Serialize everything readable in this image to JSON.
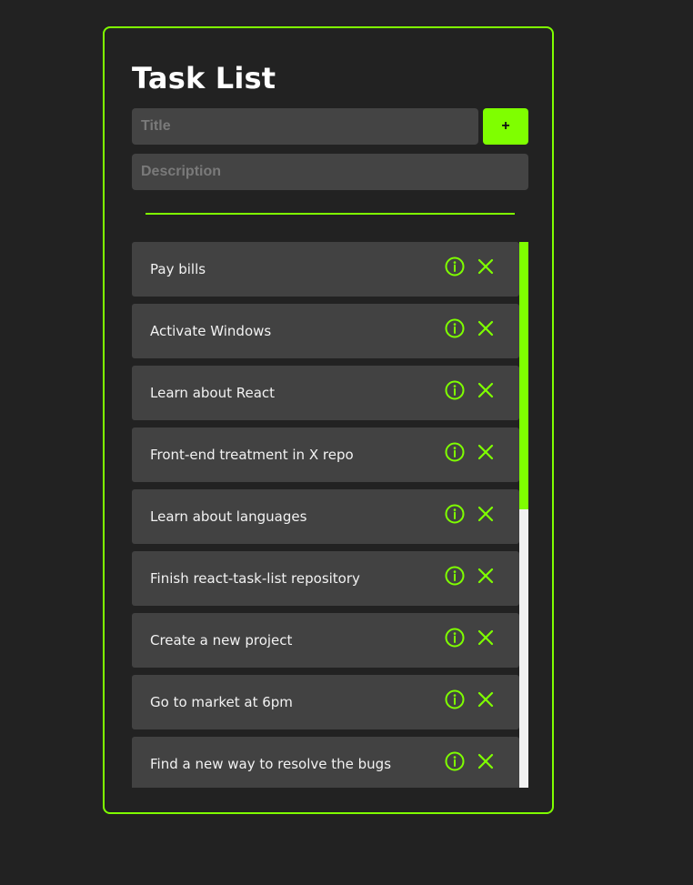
{
  "app": {
    "title": "Task List"
  },
  "form": {
    "title_placeholder": "Title",
    "title_value": "",
    "description_placeholder": "Description",
    "description_value": "",
    "add_label": "+"
  },
  "tasks": [
    {
      "label": "Pay bills"
    },
    {
      "label": "Activate Windows"
    },
    {
      "label": "Learn about React"
    },
    {
      "label": "Front-end treatment in X repo"
    },
    {
      "label": "Learn about languages"
    },
    {
      "label": "Finish react-task-list repository"
    },
    {
      "label": "Create a new project"
    },
    {
      "label": "Go to market at 6pm"
    },
    {
      "label": "Find a new way to resolve the bugs"
    }
  ],
  "icons": {
    "info": "info-circle-icon",
    "delete": "close-x-icon"
  },
  "scroll": {
    "visible_fraction": 0.49,
    "position": 0
  },
  "colors": {
    "accent": "#7fff00",
    "background": "#222222",
    "item_background": "#424242",
    "input_background": "#444444",
    "text": "#ffffff"
  }
}
